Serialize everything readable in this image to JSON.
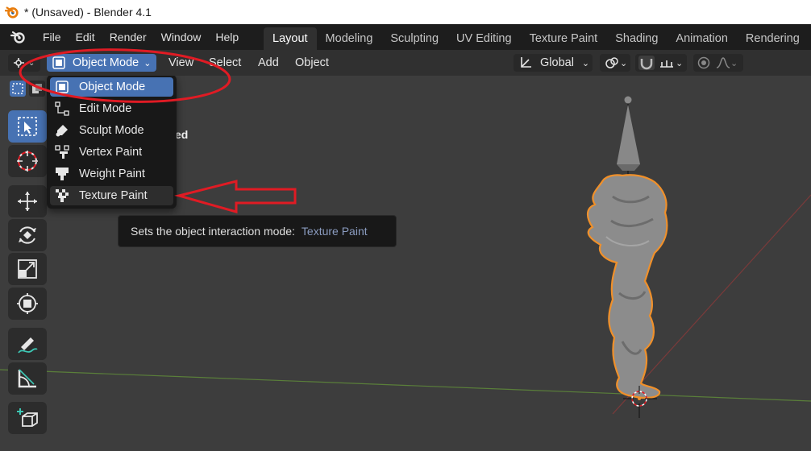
{
  "window": {
    "title": "* (Unsaved) - Blender 4.1"
  },
  "menubar": {
    "items": [
      "File",
      "Edit",
      "Render",
      "Window",
      "Help"
    ],
    "workspaces": [
      "Layout",
      "Modeling",
      "Sculpting",
      "UV Editing",
      "Texture Paint",
      "Shading",
      "Animation",
      "Rendering"
    ],
    "active_workspace": "Layout"
  },
  "header": {
    "mode_label": "Object Mode",
    "menus": [
      "View",
      "Select",
      "Add",
      "Object"
    ],
    "transform_orientation": "Global"
  },
  "viewport": {
    "overlay_text": "ed"
  },
  "mode_dropdown": {
    "items": [
      {
        "label": "Object Mode",
        "icon": "object-mode-icon",
        "state": "selected"
      },
      {
        "label": "Edit Mode",
        "icon": "edit-mode-icon",
        "state": "normal"
      },
      {
        "label": "Sculpt Mode",
        "icon": "sculpt-mode-icon",
        "state": "normal"
      },
      {
        "label": "Vertex Paint",
        "icon": "vertex-paint-icon",
        "state": "normal"
      },
      {
        "label": "Weight Paint",
        "icon": "weight-paint-icon",
        "state": "normal"
      },
      {
        "label": "Texture Paint",
        "icon": "texture-paint-icon",
        "state": "hover"
      }
    ]
  },
  "tooltip": {
    "text": "Sets the object interaction mode:",
    "value": "Texture Paint"
  },
  "colors": {
    "accent": "#4772b3",
    "annotation_red": "#e01b24",
    "selection_orange": "#f0902a"
  }
}
